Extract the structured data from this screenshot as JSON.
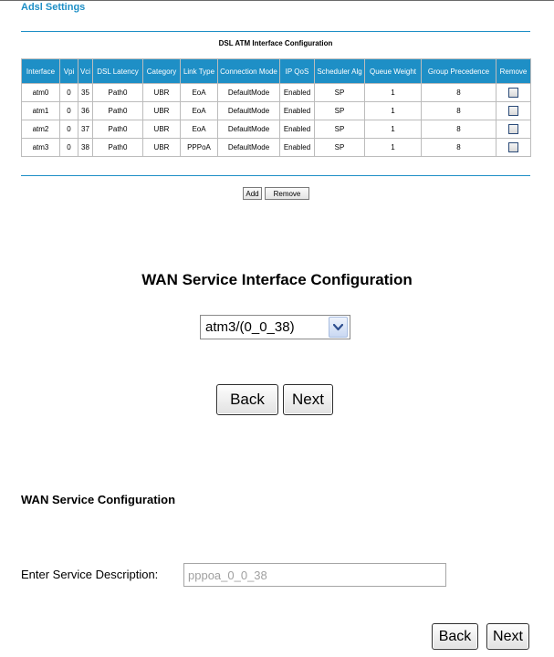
{
  "adsl": {
    "title": "Adsl Settings",
    "table_title": "DSL ATM Interface Configuration",
    "columns": [
      "Interface",
      "Vpi",
      "Vci",
      "DSL Latency",
      "Category",
      "Link Type",
      "Connection Mode",
      "IP QoS",
      "Scheduler Alg",
      "Queue Weight",
      "Group Precedence",
      "Remove"
    ],
    "rows": [
      {
        "interface": "atm0",
        "vpi": "0",
        "vci": "35",
        "latency": "Path0",
        "category": "UBR",
        "link_type": "EoA",
        "mode": "DefaultMode",
        "qos": "Enabled",
        "scheduler": "SP",
        "weight": "1",
        "precedence": "8",
        "remove_checked": false
      },
      {
        "interface": "atm1",
        "vpi": "0",
        "vci": "36",
        "latency": "Path0",
        "category": "UBR",
        "link_type": "EoA",
        "mode": "DefaultMode",
        "qos": "Enabled",
        "scheduler": "SP",
        "weight": "1",
        "precedence": "8",
        "remove_checked": false
      },
      {
        "interface": "atm2",
        "vpi": "0",
        "vci": "37",
        "latency": "Path0",
        "category": "UBR",
        "link_type": "EoA",
        "mode": "DefaultMode",
        "qos": "Enabled",
        "scheduler": "SP",
        "weight": "1",
        "precedence": "8",
        "remove_checked": false
      },
      {
        "interface": "atm3",
        "vpi": "0",
        "vci": "38",
        "latency": "Path0",
        "category": "UBR",
        "link_type": "PPPoA",
        "mode": "DefaultMode",
        "qos": "Enabled",
        "scheduler": "SP",
        "weight": "1",
        "precedence": "8",
        "remove_checked": false
      }
    ],
    "add_label": "Add",
    "remove_label": "Remove",
    "accent": "#1e8fc6"
  },
  "wan_interface": {
    "title": "WAN Service Interface Configuration",
    "selected": "atm3/(0_0_38)",
    "back_label": "Back",
    "next_label": "Next"
  },
  "wan_service": {
    "title": "WAN Service Configuration",
    "description_label": "Enter Service Description:",
    "description_value": "pppoa_0_0_38",
    "back_label": "Back",
    "next_label": "Next"
  }
}
